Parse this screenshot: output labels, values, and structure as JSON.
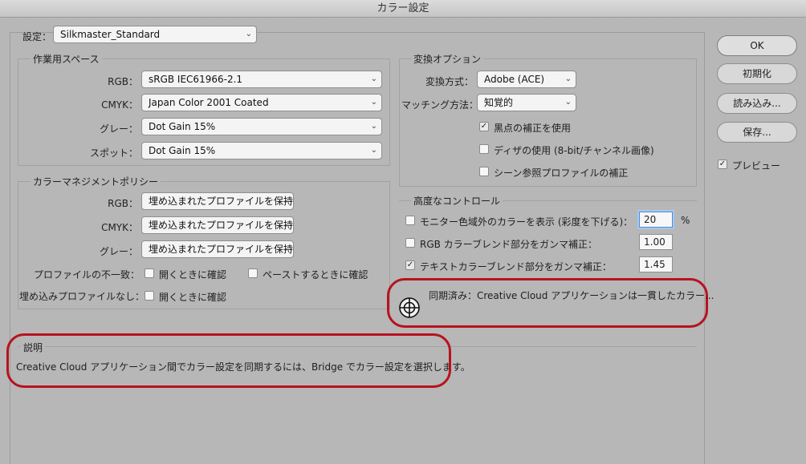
{
  "window": {
    "title": "カラー設定"
  },
  "settings": {
    "label": "設定：",
    "value": "Silkmaster_Standard"
  },
  "workspace": {
    "title": "作業用スペース",
    "rgb": {
      "label": "RGB：",
      "value": "sRGB IEC61966-2.1"
    },
    "cmyk": {
      "label": "CMYK：",
      "value": "Japan Color 2001 Coated"
    },
    "gray": {
      "label": "グレー：",
      "value": "Dot Gain 15%"
    },
    "spot": {
      "label": "スポット：",
      "value": "Dot Gain 15%"
    }
  },
  "policy": {
    "title": "カラーマネジメントポリシー",
    "rgb": {
      "label": "RGB：",
      "value": "埋め込まれたプロファイルを保持"
    },
    "cmyk": {
      "label": "CMYK：",
      "value": "埋め込まれたプロファイルを保持"
    },
    "gray": {
      "label": "グレー：",
      "value": "埋め込まれたプロファイルを保持"
    },
    "mismatch": {
      "label": "プロファイルの不一致：",
      "open_label": "開くときに確認",
      "open_checked": false,
      "paste_label": "ペーストするときに確認",
      "paste_checked": false
    },
    "missing": {
      "label": "埋め込みプロファイルなし：",
      "open_label": "開くときに確認",
      "open_checked": false
    }
  },
  "conversion": {
    "title": "変換オプション",
    "engine": {
      "label": "変換方式：",
      "value": "Adobe (ACE)"
    },
    "intent": {
      "label": "マッチング方法：",
      "value": "知覚的"
    },
    "bpc": {
      "label": "黒点の補正を使用",
      "checked": true
    },
    "dither": {
      "label": "ディザの使用 (8-bit/チャンネル画像)",
      "checked": false
    },
    "scene": {
      "label": "シーン参照プロファイルの補正",
      "checked": false
    }
  },
  "advanced": {
    "title": "高度なコントロール",
    "desaturate": {
      "label": "モニター色域外のカラーを表示 (彩度を下げる)：",
      "value": "20",
      "unit": "%",
      "checked": false
    },
    "rgb_blend": {
      "label": "RGB カラーブレンド部分をガンマ補正：",
      "value": "1.00",
      "checked": false
    },
    "text_blend": {
      "label": "テキストカラーブレンド部分をガンマ補正：",
      "value": "1.45",
      "checked": true
    }
  },
  "sync": {
    "text": "同期済み：Creative Cloud アプリケーションは一貫したカラー..."
  },
  "description": {
    "title": "説明",
    "text": "Creative Cloud アプリケーション間でカラー設定を同期するには、Bridge でカラー設定を選択します。"
  },
  "buttons": {
    "ok": "OK",
    "reset": "初期化",
    "load": "読み込み...",
    "save": "保存..."
  },
  "preview": {
    "label": "プレビュー",
    "checked": true
  },
  "colors": {
    "highlight_oval": "#b8121e",
    "focus": "#4a8fd8"
  }
}
